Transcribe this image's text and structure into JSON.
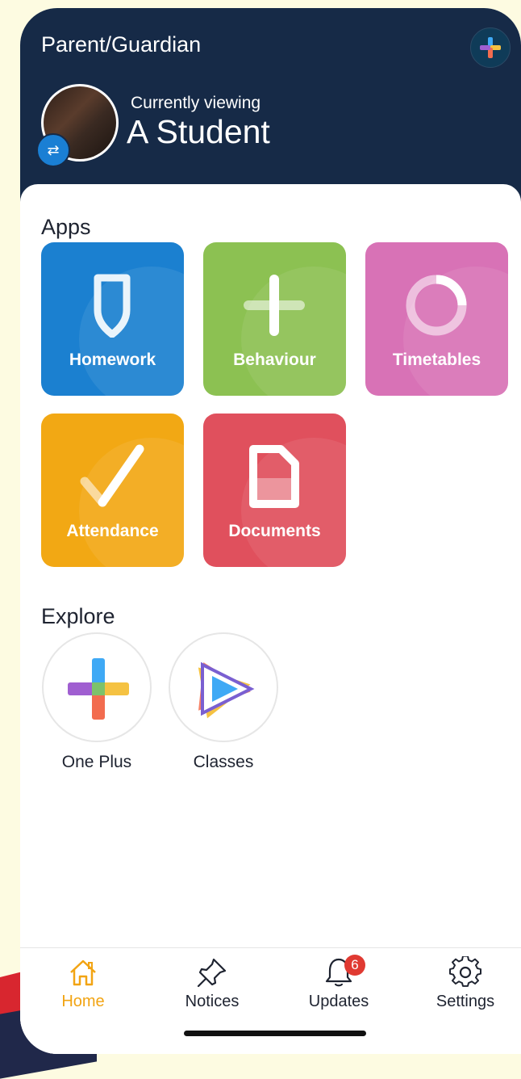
{
  "header": {
    "role": "Parent/Guardian",
    "viewing_label": "Currently viewing",
    "student_name": "A Student"
  },
  "apps": {
    "title": "Apps",
    "tiles": [
      {
        "label": "Homework",
        "color": "#1b80d0"
      },
      {
        "label": "Behaviour",
        "color": "#8cc152"
      },
      {
        "label": "Timetables",
        "color": "#d872b6"
      },
      {
        "label": "Attendance",
        "color": "#f2a814"
      },
      {
        "label": "Documents",
        "color": "#e0505d"
      }
    ]
  },
  "explore": {
    "title": "Explore",
    "items": [
      {
        "label": "One Plus"
      },
      {
        "label": "Classes"
      }
    ]
  },
  "tabbar": {
    "items": [
      {
        "label": "Home",
        "icon": "home-icon",
        "active": true
      },
      {
        "label": "Notices",
        "icon": "pin-icon"
      },
      {
        "label": "Updates",
        "icon": "bell-icon",
        "badge": "6"
      },
      {
        "label": "Settings",
        "icon": "gear-icon"
      }
    ],
    "active_color": "#f2a413"
  }
}
